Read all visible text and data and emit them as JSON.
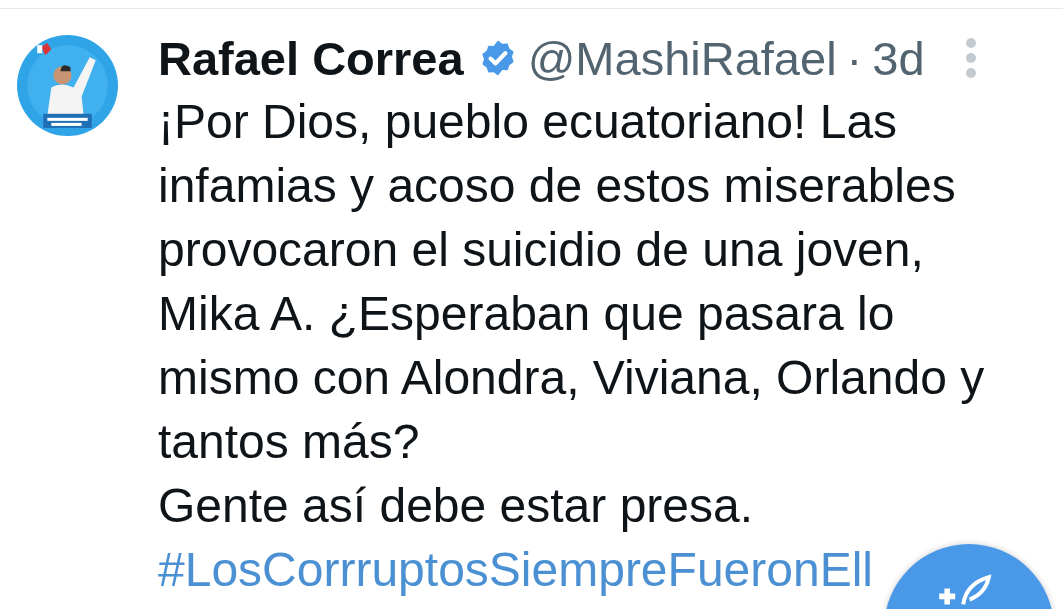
{
  "tweet": {
    "author": "Rafael Correa",
    "verified": true,
    "handle": "@MashiRafael",
    "separator": "·",
    "time": "3d",
    "text": "¡Por Dios, pueblo ecuatoriano! Las\ninfamias y acoso de estos miserables\nprovocaron el suicidio de una joven,\nMika A. ¿Esperaban que pasara lo\nmismo con Alondra, Viviana, Orlando y\ntantos más?\nGente así debe estar presa.",
    "hashtag": "#LosCorrruptosSiempreFueronEll"
  }
}
